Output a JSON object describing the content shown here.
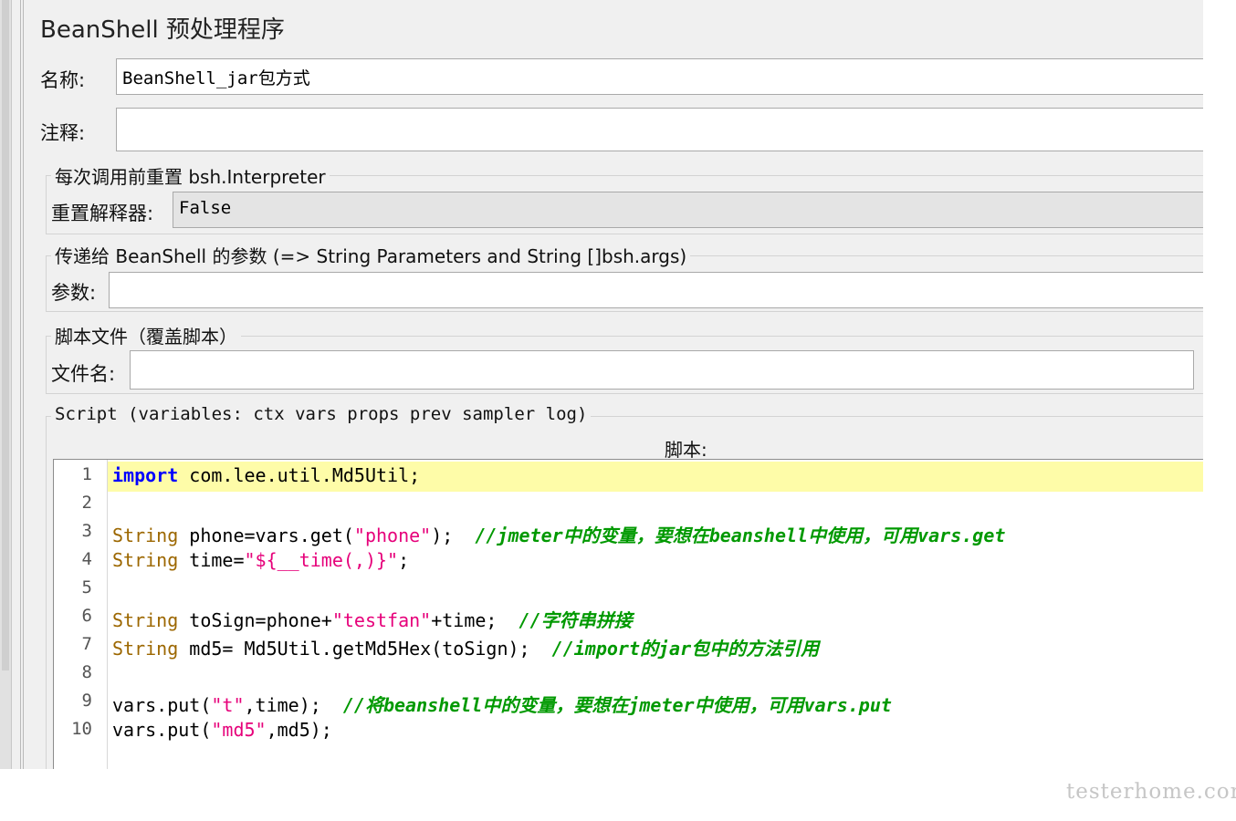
{
  "panel": {
    "title": "BeanShell 预处理程序"
  },
  "fields": {
    "name_label": "名称:",
    "name_value": "BeanShell_jar包方式",
    "comment_label": "注释:",
    "comment_value": ""
  },
  "reset_group": {
    "legend": "每次调用前重置 bsh.Interpreter",
    "label": "重置解释器:",
    "value": "False"
  },
  "params_group": {
    "legend": "传递给 BeanShell 的参数 (=> String Parameters and String []bsh.args)",
    "label": "参数:",
    "value": ""
  },
  "file_group": {
    "legend": "脚本文件（覆盖脚本）",
    "label": "文件名:",
    "value": ""
  },
  "script_group": {
    "legend": "Script (variables: ctx vars props prev sampler log)",
    "caption": "脚本:"
  },
  "editor": {
    "highlight_color": "#fefca8",
    "lines": [
      {
        "no": "1",
        "tokens": [
          {
            "t": "import",
            "c": "kw"
          },
          {
            "t": " com.lee.util.Md5Util;",
            "c": ""
          }
        ]
      },
      {
        "no": "2",
        "tokens": []
      },
      {
        "no": "3",
        "tokens": [
          {
            "t": "String",
            "c": "ty"
          },
          {
            "t": " phone=vars.get(",
            "c": ""
          },
          {
            "t": "\"phone\"",
            "c": "st"
          },
          {
            "t": ");  ",
            "c": ""
          },
          {
            "t": "//jmeter中的变量，要想在beanshell中使用，可用vars.get",
            "c": "cm"
          }
        ]
      },
      {
        "no": "4",
        "tokens": [
          {
            "t": "String",
            "c": "ty"
          },
          {
            "t": " time=",
            "c": ""
          },
          {
            "t": "\"${__time(,)}\"",
            "c": "st"
          },
          {
            "t": ";",
            "c": ""
          }
        ]
      },
      {
        "no": "5",
        "tokens": []
      },
      {
        "no": "6",
        "tokens": [
          {
            "t": "String",
            "c": "ty"
          },
          {
            "t": " toSign=phone+",
            "c": ""
          },
          {
            "t": "\"testfan\"",
            "c": "st"
          },
          {
            "t": "+time;  ",
            "c": ""
          },
          {
            "t": "//字符串拼接",
            "c": "cm"
          }
        ]
      },
      {
        "no": "7",
        "tokens": [
          {
            "t": "String",
            "c": "ty"
          },
          {
            "t": " md5= Md5Util.getMd5Hex(toSign);  ",
            "c": ""
          },
          {
            "t": "//import的jar包中的方法引用",
            "c": "cm"
          }
        ]
      },
      {
        "no": "8",
        "tokens": []
      },
      {
        "no": "9",
        "tokens": [
          {
            "t": "vars.put(",
            "c": ""
          },
          {
            "t": "\"t\"",
            "c": "st"
          },
          {
            "t": ",time);  ",
            "c": ""
          },
          {
            "t": "//将beanshell中的变量，要想在jmeter中使用，可用vars.put",
            "c": "cm"
          }
        ]
      },
      {
        "no": "10",
        "tokens": [
          {
            "t": "vars.put(",
            "c": ""
          },
          {
            "t": "\"md5\"",
            "c": "st"
          },
          {
            "t": ",md5);",
            "c": ""
          }
        ]
      }
    ]
  },
  "watermark": "testerhome.com"
}
